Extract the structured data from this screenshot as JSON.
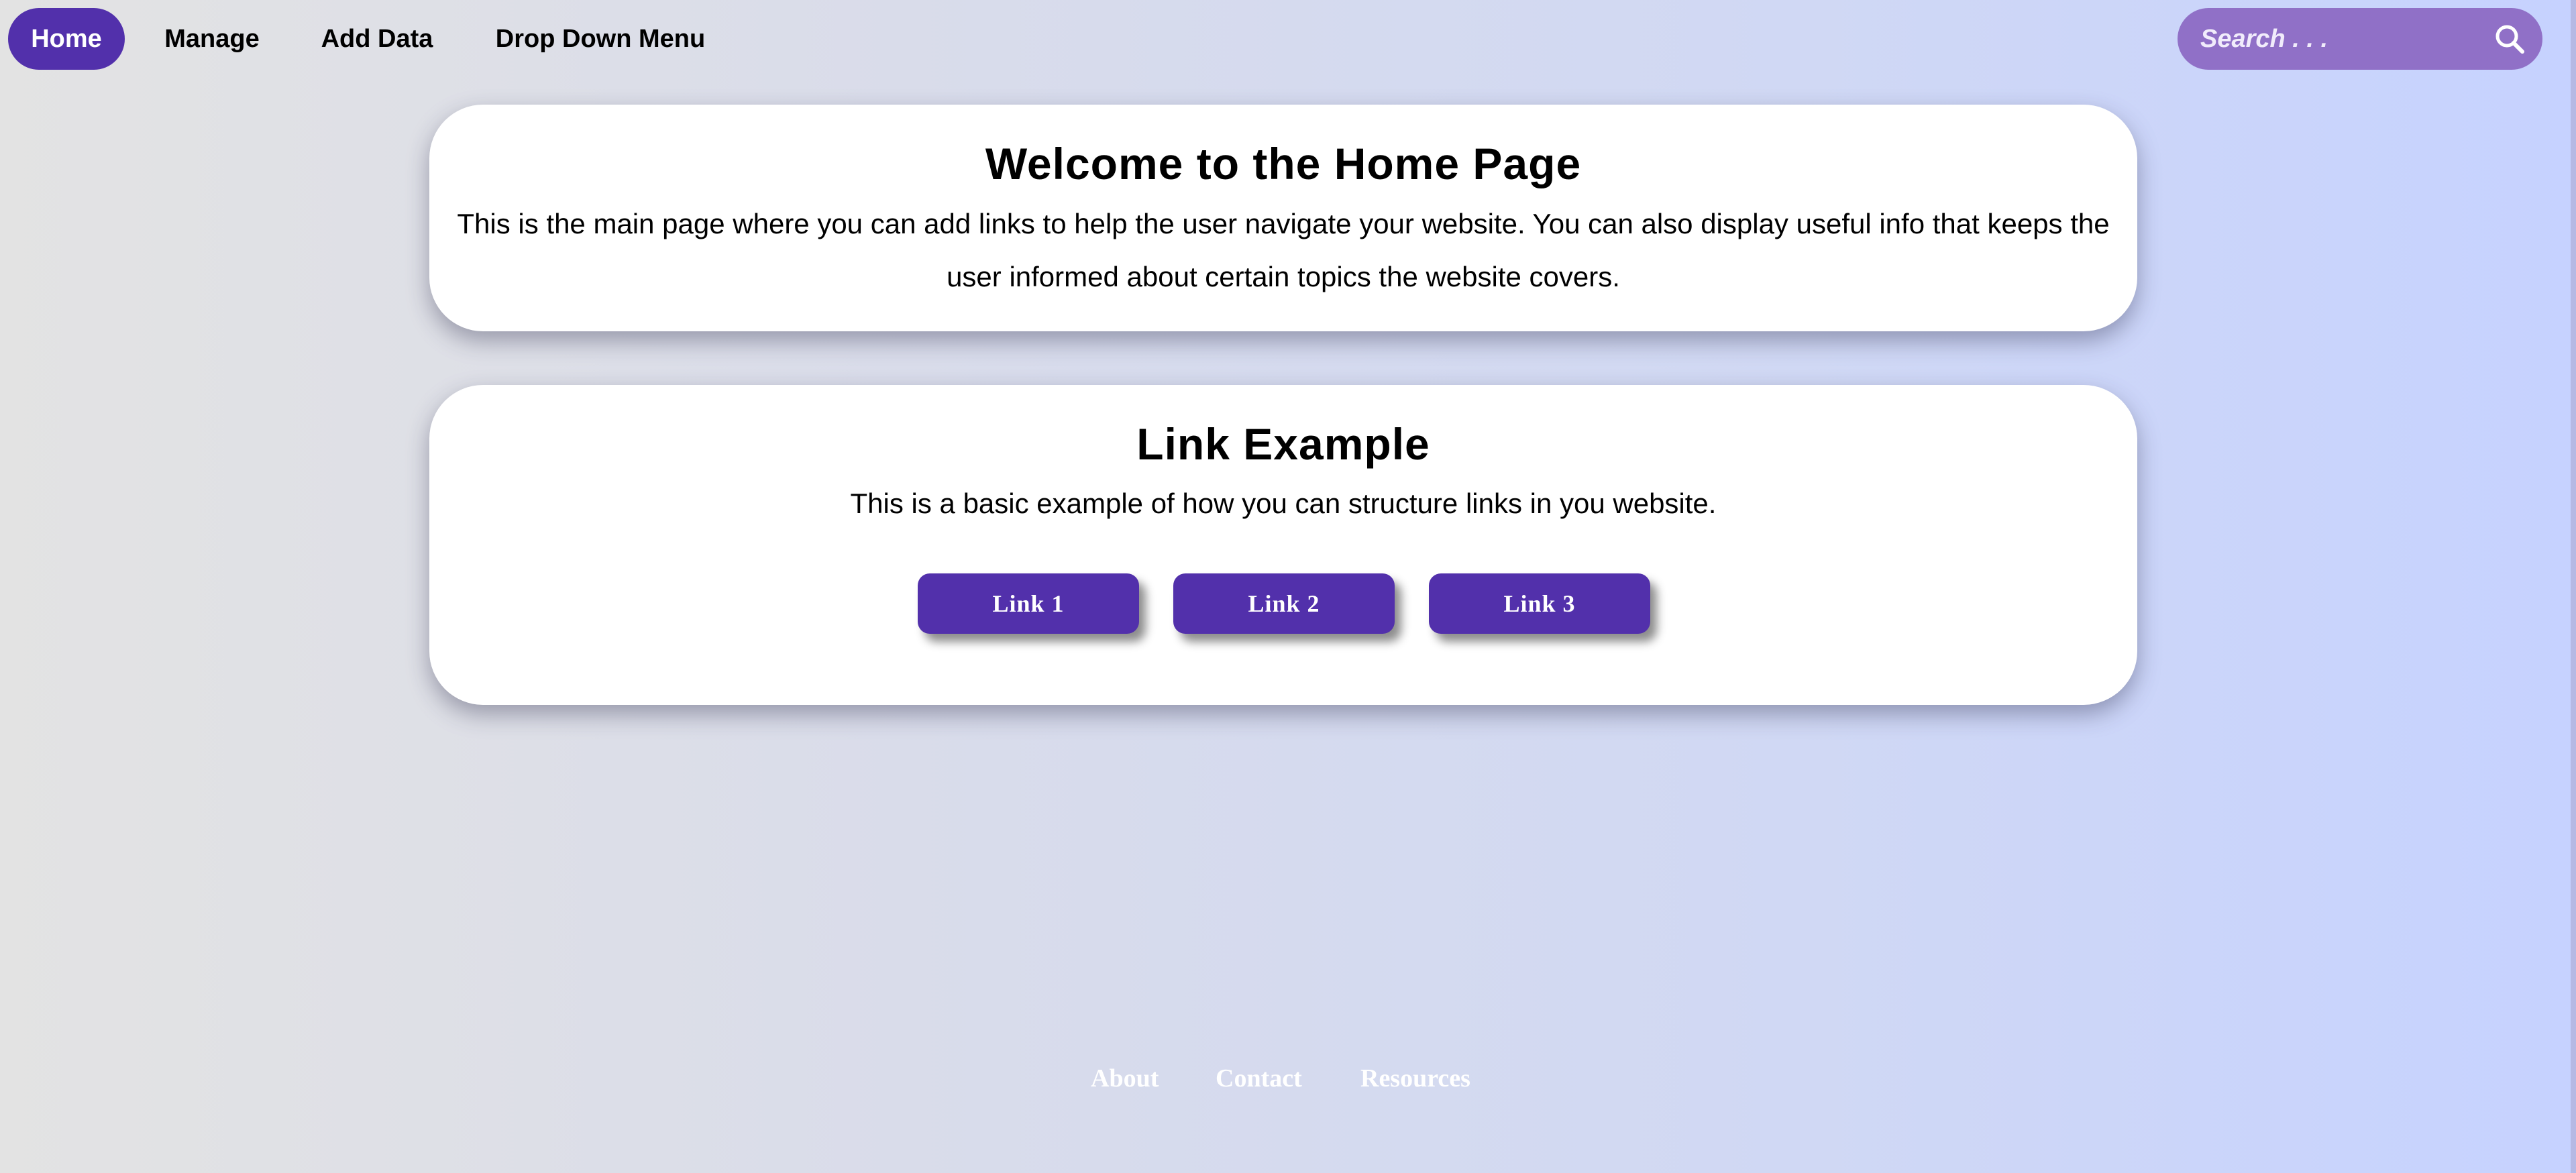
{
  "nav": {
    "items": [
      {
        "label": "Home",
        "active": true
      },
      {
        "label": "Manage",
        "active": false
      },
      {
        "label": "Add Data",
        "active": false
      },
      {
        "label": "Drop Down Menu",
        "active": false
      }
    ],
    "search": {
      "placeholder": "Search . . .",
      "icon": "search-icon"
    }
  },
  "welcome": {
    "title": "Welcome to the Home Page",
    "text": "This is the main page where you can add links to help the user navigate your website. You can also display useful info that keeps the user informed about certain topics the website covers."
  },
  "link_example": {
    "title": "Link Example",
    "text": "This is a basic example of how you can structure links in you website.",
    "links": [
      "Link 1",
      "Link 2",
      "Link 3"
    ]
  },
  "footer": {
    "links": [
      "About",
      "Contact",
      "Resources"
    ]
  },
  "colors": {
    "accent": "#5230ab",
    "search_bg": "#9070c7",
    "card_bg": "#ffffff",
    "footer_text": "#ffffff"
  }
}
